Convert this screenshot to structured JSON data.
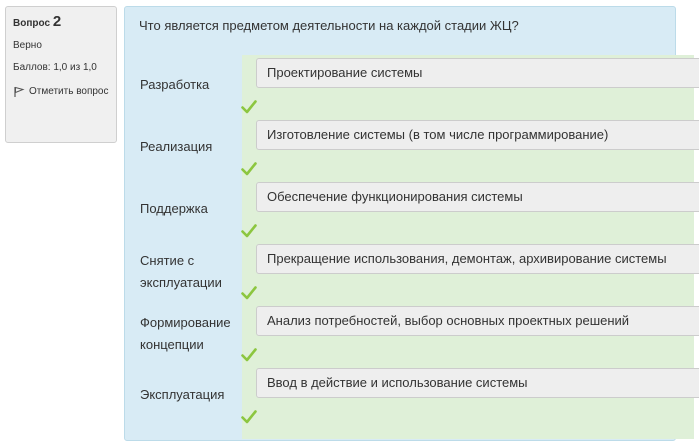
{
  "info": {
    "question_label": "Вопрос",
    "question_number": "2",
    "state": "Верно",
    "grade": "Баллов: 1,0 из 1,0",
    "flag_label": "Отметить вопрос"
  },
  "question": {
    "text": "Что является предметом деятельности на каждой стадии ЖЦ?",
    "rows": [
      {
        "stem": "Разработка",
        "answer": "Проектирование системы",
        "correct": true
      },
      {
        "stem": "Реализация",
        "answer": "Изготовление системы (в том числе программирование)",
        "correct": true
      },
      {
        "stem": "Поддержка",
        "answer": "Обеспечение функционирования системы",
        "correct": true
      },
      {
        "stem": "Снятие с эксплуатации",
        "answer": "Прекращение использования, демонтаж, архивирование системы",
        "correct": true
      },
      {
        "stem": "Формирование концепции",
        "answer": "Анализ потребностей, выбор основных проектных решений",
        "correct": true
      },
      {
        "stem": "Эксплуатация",
        "answer": "Ввод в действие и использование системы",
        "correct": true
      }
    ]
  },
  "colors": {
    "info_bg": "#f0f0f0",
    "content_bg": "#d8ebf5",
    "correct_bg": "#dff0d8",
    "check": "#8cc63f"
  }
}
